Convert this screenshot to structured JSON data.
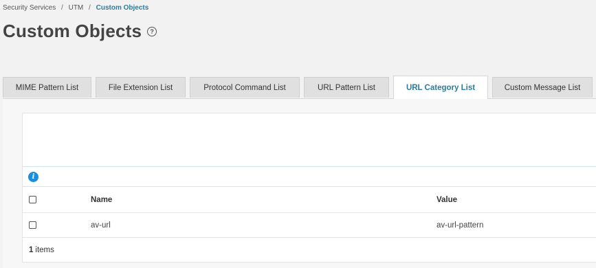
{
  "breadcrumb": {
    "items": [
      "Security Services",
      "UTM"
    ],
    "current": "Custom Objects",
    "separator": "/"
  },
  "page": {
    "title": "Custom Objects",
    "help_icon": "?"
  },
  "tabs": [
    {
      "label": "MIME Pattern List",
      "active": false
    },
    {
      "label": "File Extension List",
      "active": false
    },
    {
      "label": "Protocol Command List",
      "active": false
    },
    {
      "label": "URL Pattern List",
      "active": false
    },
    {
      "label": "URL Category List",
      "active": true
    },
    {
      "label": "Custom Message List",
      "active": false
    }
  ],
  "grid": {
    "info_icon": "i",
    "columns": {
      "name": "Name",
      "value": "Value"
    },
    "rows": [
      {
        "name": "av-url",
        "value": "av-url-pattern",
        "checked": false
      }
    ],
    "footer": {
      "count": "1",
      "label": "items"
    }
  },
  "colors": {
    "accent": "#2a7da0",
    "info": "#1a8fe0",
    "background": "#f2f2f2"
  }
}
